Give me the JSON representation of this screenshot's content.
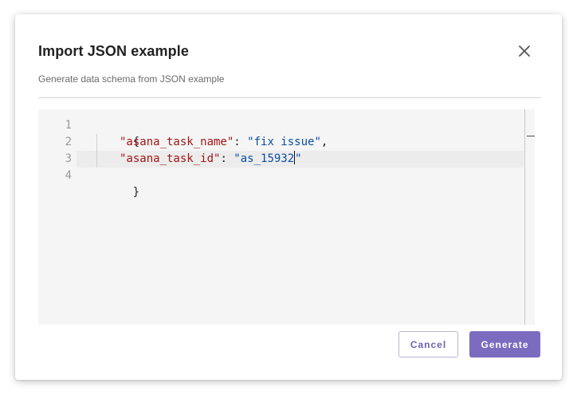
{
  "dialog": {
    "title": "Import JSON example",
    "subtitle": "Generate data schema from JSON example",
    "close_icon": "close-icon"
  },
  "editor": {
    "line_numbers": [
      "1",
      "2",
      "3",
      "4"
    ],
    "lines": {
      "open_brace": "{",
      "line2_key": "\"asana_task_name\"",
      "line2_sep": ": ",
      "line2_value": "\"fix issue\"",
      "line2_comma": ",",
      "line3_key": "\"asana_task_id\"",
      "line3_sep": ": ",
      "line3_value_before_cursor": "\"as_15932",
      "line3_value_after_cursor": "\"",
      "close_brace": "}"
    }
  },
  "actions": {
    "cancel_label": "Cancel",
    "generate_label": "Generate"
  },
  "colors": {
    "accent": "#7b6cc0",
    "json_key": "#a31515",
    "json_string": "#0b4fa1"
  }
}
